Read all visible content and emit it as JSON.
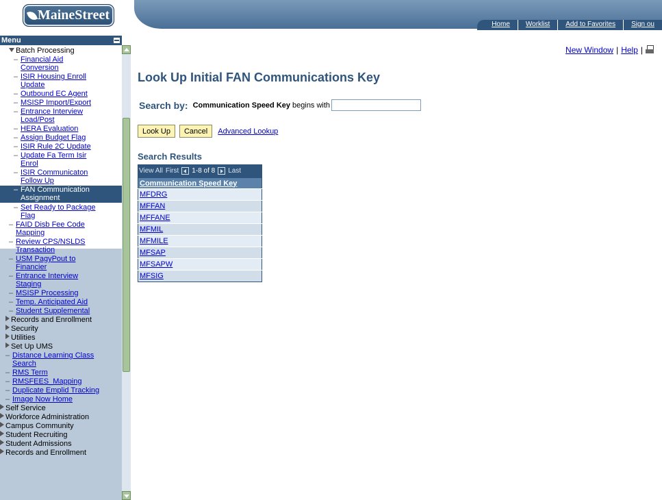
{
  "header": {
    "logo_text": "MaineStreet",
    "links": [
      "Home",
      "Worklist",
      "Add to Favorites",
      "Sign ou"
    ]
  },
  "menu": {
    "title": "Menu",
    "items": [
      {
        "label": "Batch Processing",
        "kind": "folder-open",
        "level": 1,
        "color": "#000000"
      },
      {
        "label": "Financial Aid\nConversion",
        "kind": "link",
        "level": 2
      },
      {
        "label": "ISIR Housing Enroll\nUpdate",
        "kind": "link",
        "level": 2
      },
      {
        "label": "Outbound EC Agent",
        "kind": "link",
        "level": 2
      },
      {
        "label": "MSISP Import/Export",
        "kind": "link",
        "level": 2
      },
      {
        "label": "Entrance Interview\nLoad/Post",
        "kind": "link",
        "level": 2
      },
      {
        "label": "HERA Evaluation",
        "kind": "link",
        "level": 2
      },
      {
        "label": "Assign Budget Flag",
        "kind": "link",
        "level": 2
      },
      {
        "label": "ISIR Rule 2C Update",
        "kind": "link",
        "level": 2
      },
      {
        "label": "Update Fa Term Isir\nEnrol",
        "kind": "link",
        "level": 2
      },
      {
        "label": "ISIR Communicaton\nFollow Up",
        "kind": "link",
        "level": 2
      },
      {
        "label": "FAN Communication\nAssignment",
        "kind": "selected",
        "level": 2
      },
      {
        "label": "Set Ready to Package\nFlag",
        "kind": "link",
        "level": 2
      },
      {
        "label": "FAID Disb Fee Code\nMapping",
        "kind": "link",
        "level": 1
      },
      {
        "label": "Review CPS/NSLDS\nTransaction",
        "kind": "link",
        "level": 1
      },
      {
        "label": "USM PagyPout to\nFinancier",
        "kind": "link",
        "level": 1
      },
      {
        "label": "Entrance Interview\nStaging",
        "kind": "link",
        "level": 1
      },
      {
        "label": "MSISP Processing",
        "kind": "link",
        "level": 1
      },
      {
        "label": "Temp. Anticipated Aid",
        "kind": "link",
        "level": 1
      },
      {
        "label": "Student Supplemental",
        "kind": "link",
        "level": 1
      },
      {
        "label": "Records and Enrollment",
        "kind": "folder",
        "level": 0
      },
      {
        "label": "Security",
        "kind": "folder",
        "level": 0
      },
      {
        "label": "Utilities",
        "kind": "folder",
        "level": 0
      },
      {
        "label": "Set Up UMS",
        "kind": "folder",
        "level": 0
      },
      {
        "label": "Distance Learning Class\nSearch",
        "kind": "link",
        "level": 0
      },
      {
        "label": "RMS Term",
        "kind": "link",
        "level": 0
      },
      {
        "label": "RMSFEES_Mapping",
        "kind": "link",
        "level": 0
      },
      {
        "label": "Duplicate Emplid Tracking",
        "kind": "link",
        "level": 0
      },
      {
        "label": "Image Now Home",
        "kind": "link",
        "level": 0
      },
      {
        "label": "Self Service",
        "kind": "folder",
        "level": -1
      },
      {
        "label": "Workforce Administration",
        "kind": "folder",
        "level": -1
      },
      {
        "label": "Campus Community",
        "kind": "folder",
        "level": -1
      },
      {
        "label": "Student Recruiting",
        "kind": "folder",
        "level": -1
      },
      {
        "label": "Student Admissions",
        "kind": "folder",
        "level": -1
      },
      {
        "label": "Records and Enrollment",
        "kind": "folder",
        "level": -1
      }
    ]
  },
  "toolbar": {
    "new_window": "New Window",
    "separator": "|",
    "help": "Help",
    "separator2": "|"
  },
  "page": {
    "title": "Look Up Initial FAN Communications Key",
    "search_by": "Search by:",
    "field_label": "Communication Speed Key",
    "operator": "begins with",
    "search_value": "",
    "lookup_button": "Look Up",
    "cancel_button": "Cancel",
    "advanced_lookup": "Advanced Lookup"
  },
  "results": {
    "title": "Search Results",
    "view_all": "View All",
    "first": "First",
    "count": "1-8 of 8",
    "last": "Last",
    "column": "Communication Speed Key",
    "rows": [
      "MFDRG",
      "MFFAN",
      "MFFANE",
      "MFMIL",
      "MFMILE",
      "MFSAP",
      "MFSAPW",
      "MFSIG"
    ]
  }
}
